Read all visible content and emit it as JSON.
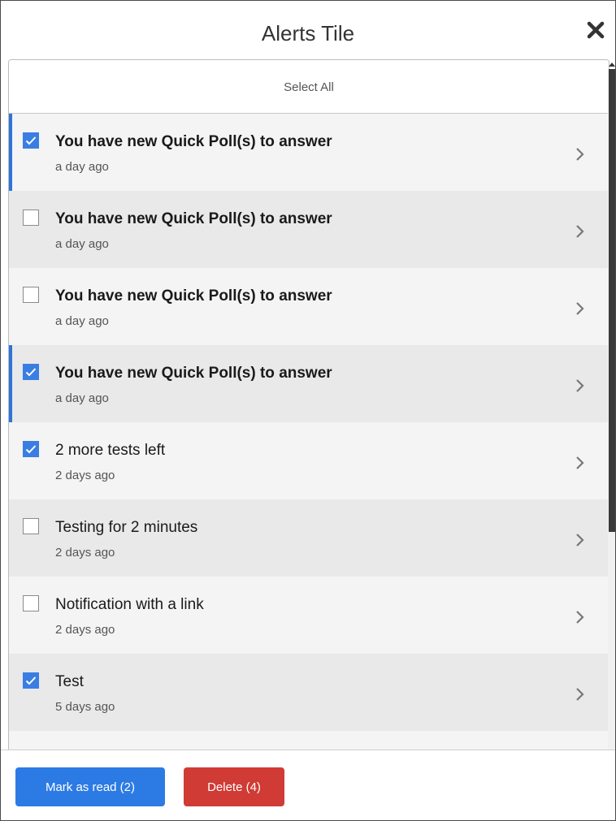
{
  "header": {
    "title": "Alerts Tile"
  },
  "select_all": {
    "label": "Select All"
  },
  "alerts": [
    {
      "title": "You have new Quick Poll(s) to answer",
      "time": "a day ago",
      "checked": true,
      "unread": true,
      "bold": true
    },
    {
      "title": "You have new Quick Poll(s) to answer",
      "time": "a day ago",
      "checked": false,
      "unread": false,
      "bold": true
    },
    {
      "title": "You have new Quick Poll(s) to answer",
      "time": "a day ago",
      "checked": false,
      "unread": false,
      "bold": true
    },
    {
      "title": "You have new Quick Poll(s) to answer",
      "time": "a day ago",
      "checked": true,
      "unread": true,
      "bold": true
    },
    {
      "title": "2 more tests left",
      "time": "2 days ago",
      "checked": true,
      "unread": false,
      "bold": false
    },
    {
      "title": "Testing for 2 minutes",
      "time": "2 days ago",
      "checked": false,
      "unread": false,
      "bold": false
    },
    {
      "title": "Notification with a link",
      "time": "2 days ago",
      "checked": false,
      "unread": false,
      "bold": false
    },
    {
      "title": "Test",
      "time": "5 days ago",
      "checked": true,
      "unread": false,
      "bold": false
    }
  ],
  "footer": {
    "mark_read_label": "Mark as read (2)",
    "delete_label": "Delete (4)"
  },
  "colors": {
    "accent": "#2c7be5",
    "danger": "#d03b35",
    "unread_bar": "#2f73da"
  },
  "icons": {
    "close": "close-icon",
    "chevron": "chevron-right-icon",
    "check": "check-icon"
  }
}
